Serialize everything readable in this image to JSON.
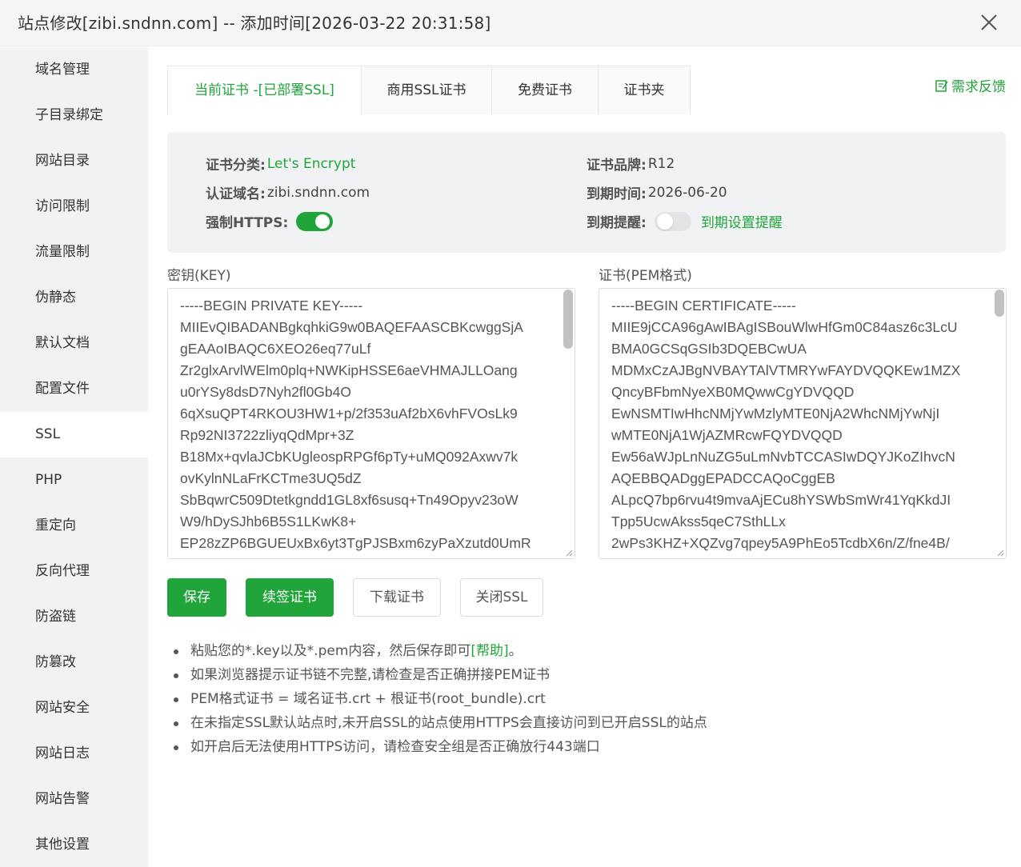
{
  "window": {
    "title": "站点修改[zibi.sndnn.com] -- 添加时间[2026-03-22 20:31:58]"
  },
  "sidebar": {
    "items": [
      {
        "label": "域名管理"
      },
      {
        "label": "子目录绑定"
      },
      {
        "label": "网站目录"
      },
      {
        "label": "访问限制"
      },
      {
        "label": "流量限制"
      },
      {
        "label": "伪静态"
      },
      {
        "label": "默认文档"
      },
      {
        "label": "配置文件"
      },
      {
        "label": "SSL",
        "active": true
      },
      {
        "label": "PHP"
      },
      {
        "label": "重定向"
      },
      {
        "label": "反向代理"
      },
      {
        "label": "防盗链"
      },
      {
        "label": "防篡改"
      },
      {
        "label": "网站安全"
      },
      {
        "label": "网站日志"
      },
      {
        "label": "网站告警"
      },
      {
        "label": "其他设置"
      }
    ]
  },
  "tabs": [
    {
      "label": "当前证书 -[已部署SSL]",
      "active": true
    },
    {
      "label": "商用SSL证书"
    },
    {
      "label": "免费证书"
    },
    {
      "label": "证书夹"
    }
  ],
  "feedback": {
    "label": "需求反馈"
  },
  "cert_info": {
    "category_label": "证书分类:",
    "category_value": "Let's Encrypt",
    "domain_label": "认证域名:",
    "domain_value": "zibi.sndnn.com",
    "https_label": "强制HTTPS:",
    "force_https": true,
    "brand_label": "证书品牌:",
    "brand_value": "R12",
    "expire_label": "到期时间:",
    "expire_value": "2026-06-20",
    "remind_label": "到期提醒:",
    "remind_enabled": false,
    "remind_link": "到期设置提醒"
  },
  "key_area": {
    "label": "密钥(KEY)",
    "content": "-----BEGIN PRIVATE KEY-----\nMIIEvQIBADANBgkqhkiG9w0BAQEFAASCBKcwggSjA\ngEAAoIBAQC6XEO26eq77uLf\nZr2glxArvlWElm0plq+NWKipHSSE6aeVHMAJLLOang\nu0rYSy8dsD7Nyh2fl0Gb4O\n6qXsuQPT4RKOU3HW1+p/2f353uAf2bX6vhFVOsLk9\nRp92NI3722zliyqQdMpr+3Z\nB18Mx+qvlaJCbKUgleospRPGf6pTy+uMQ092Axwv7k\novKylnNLaFrKCTme3UQ5dZ\nSbBqwrC509Dtetkgndd1GL8xf6susq+Tn49Opyv23oW\nW9/hDySJhb6B5S1LKwK8+\nEP28zZP6BGUEUxBx6yt3TgPJSBxm6zyPaXzutd0UmR"
  },
  "cert_area": {
    "label": "证书(PEM格式)",
    "content": "-----BEGIN CERTIFICATE-----\nMIIE9jCCA96gAwIBAgISBouWlwHfGm0C84asz6c3LcU\nBMA0GCSqGSIb3DQEBCwUA\nMDMxCzAJBgNVBAYTAlVTMRYwFAYDVQQKEw1MZX\nQncyBFbmNyeXB0MQwwCgYDVQQD\nEwNSMTIwHhcNMjYwMzlyMTE0NjA2WhcNMjYwNjI\nwMTE0NjA1WjAZMRcwFQYDVQQD\nEw56aWJpLnNuZG5uLmNvbTCCASIwDQYJKoZIhvcN\nAQEBBQADggEPADCCAQoCggEB\nALpcQ7bp6rvu4t9mvaAjECu8hYSWbSmWr41YqKkdJI\nTpp5UcwAkss5qeC7SthLLx\n2wPs3KHZ+XQZvg7qpey5A9PhEo5TcdbX6n/Z/fne4B/"
  },
  "buttons": {
    "save": "保存",
    "renew": "续签证书",
    "download": "下载证书",
    "close_ssl": "关闭SSL"
  },
  "tips": {
    "tip1_prefix": "粘贴您的*.key以及*.pem内容，然后保存即可",
    "tip1_help": "[帮助]",
    "tip1_suffix": "。",
    "tip2": "如果浏览器提示证书链不完整,请检查是否正确拼接PEM证书",
    "tip3": "PEM格式证书 = 域名证书.crt + 根证书(root_bundle).crt",
    "tip4": "在未指定SSL默认站点时,未开启SSL的站点使用HTTPS会直接访问到已开启SSL的站点",
    "tip5": "如开启后无法使用HTTPS访问，请检查安全组是否正确放行443端口"
  },
  "colors": {
    "accent": "#20a53a",
    "sidebar_bg": "#f2f2f2",
    "info_bg": "#f1f2f4"
  }
}
